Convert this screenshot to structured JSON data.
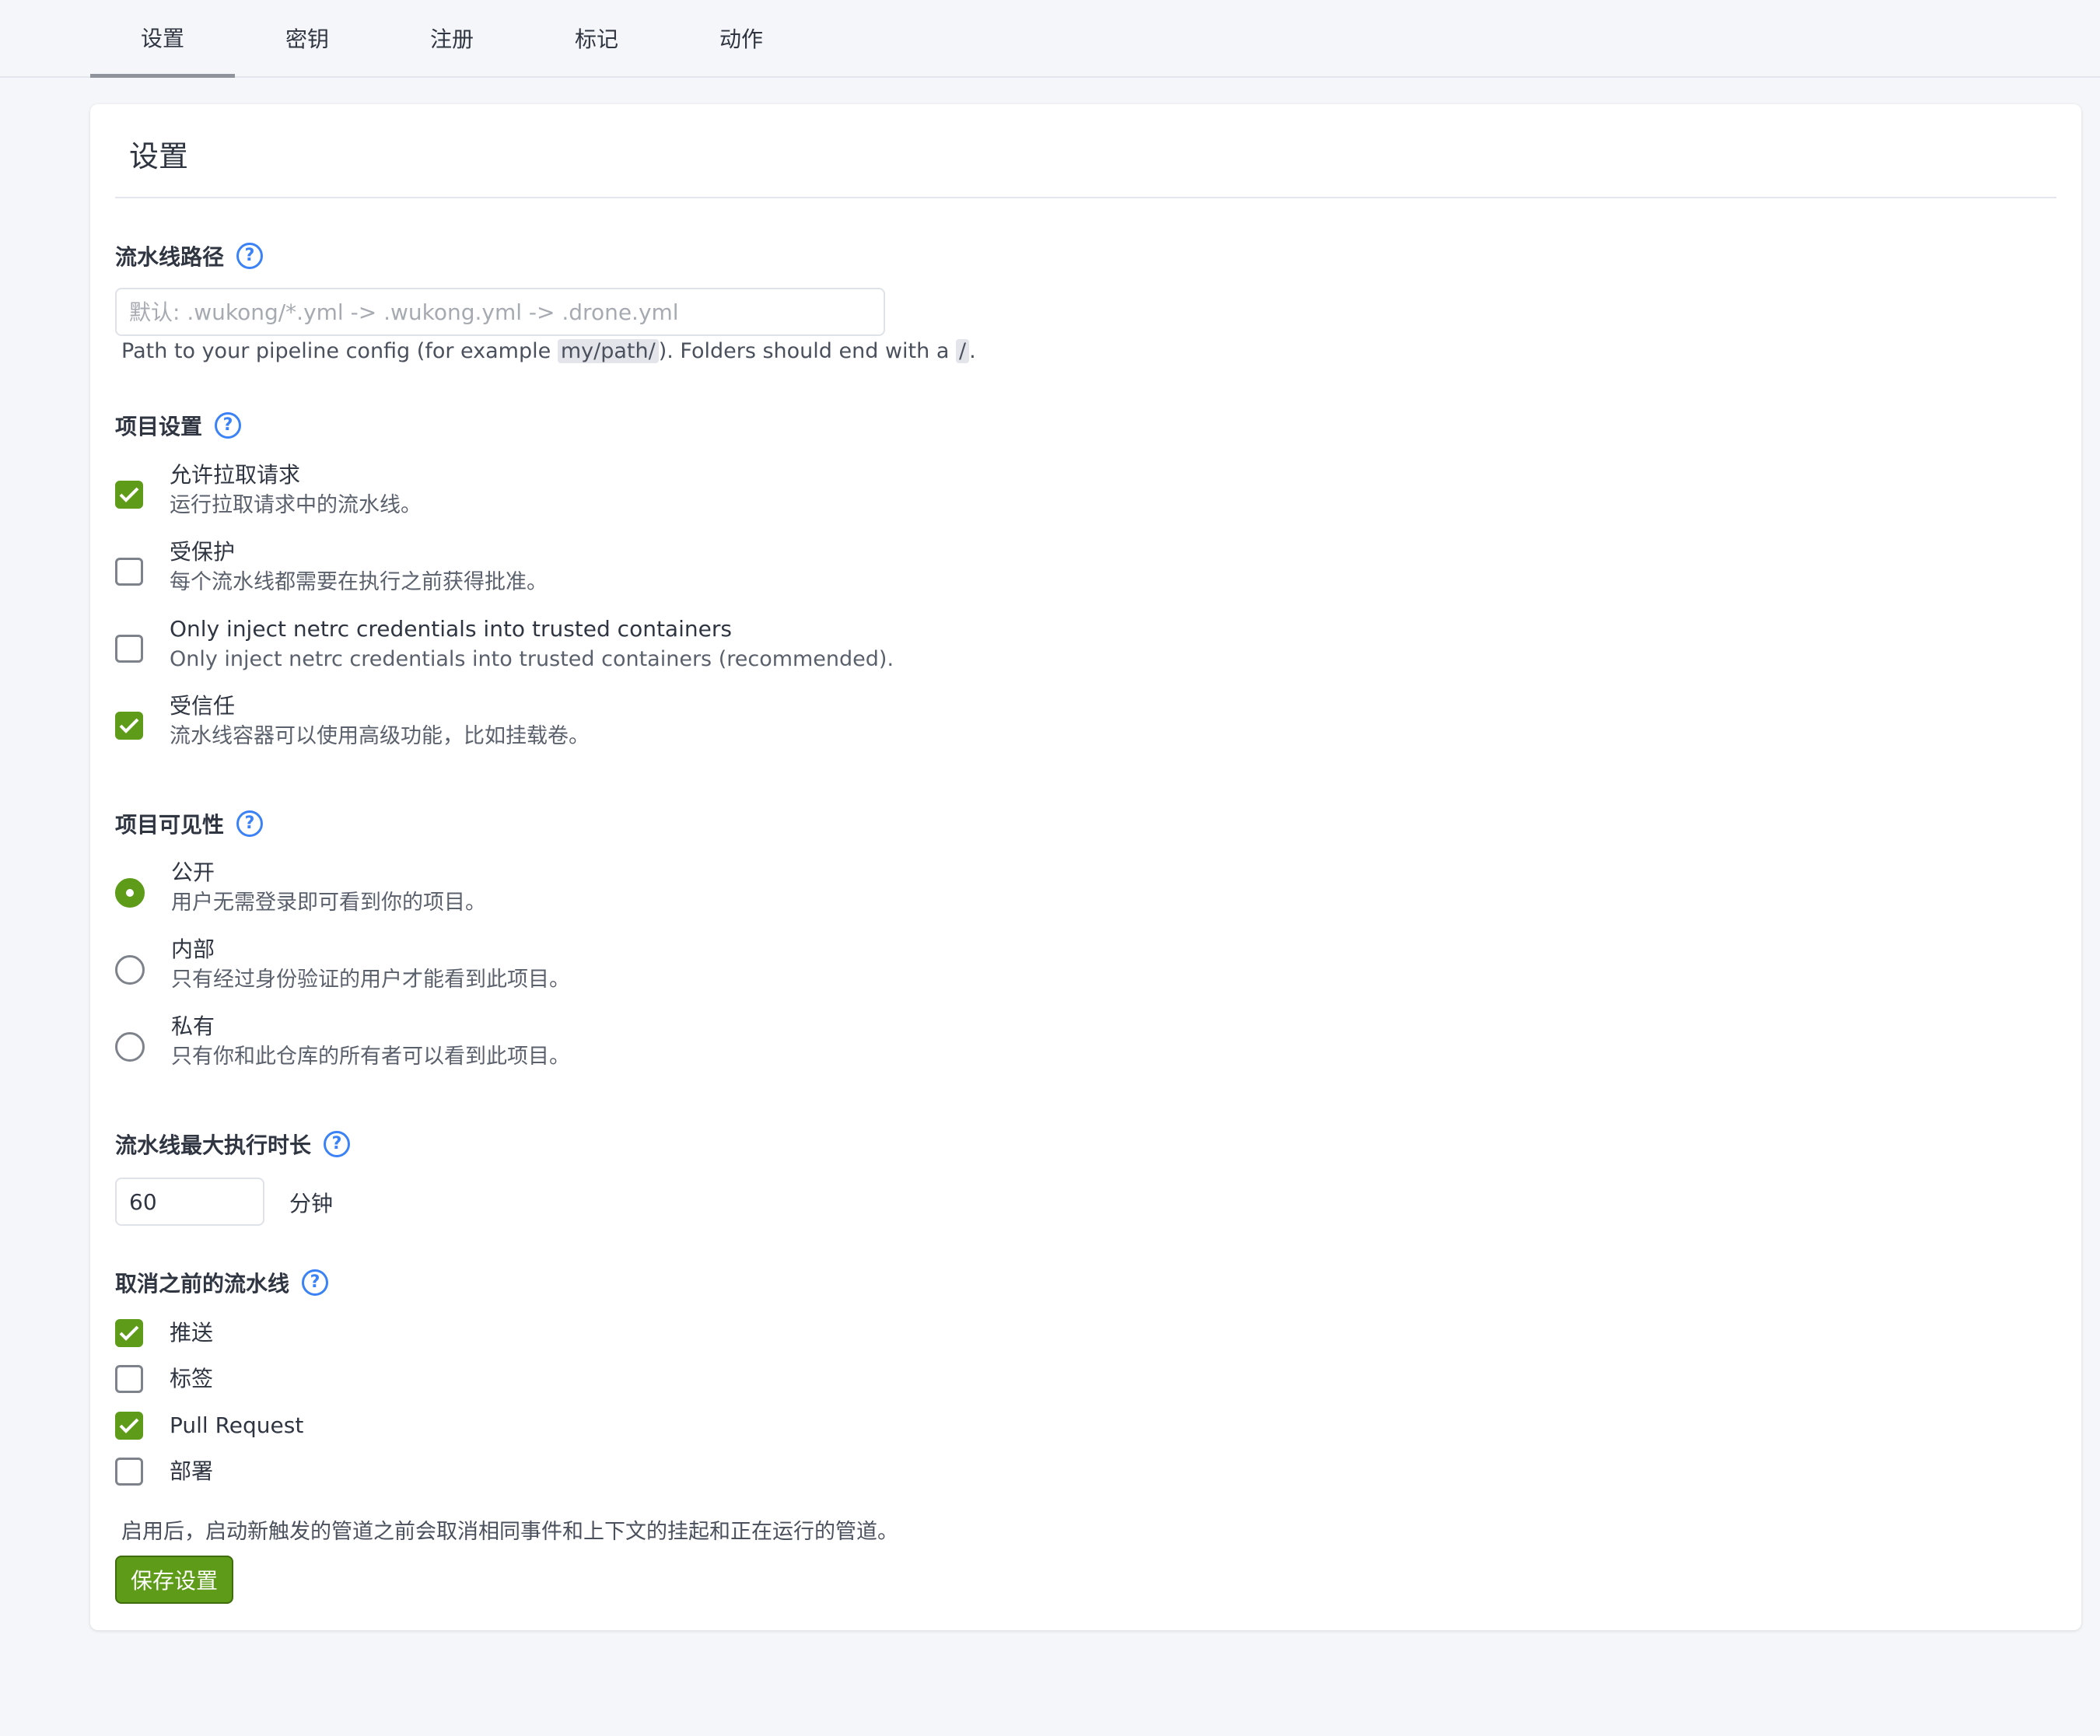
{
  "tabs": [
    "设置",
    "密钥",
    "注册",
    "标记",
    "动作"
  ],
  "active_tab": "设置",
  "card": {
    "title": "设置",
    "pipeline_path": {
      "label": "流水线路径",
      "placeholder": "默认: .wukong/*.yml -> .wukong.yml -> .drone.yml",
      "value": "",
      "hint_before": "Path to your pipeline config (for example ",
      "hint_code1": "my/path/",
      "hint_middle": "). Folders should end with a ",
      "hint_code2": "/",
      "hint_after": "."
    },
    "project_settings": {
      "label": "项目设置",
      "options": [
        {
          "title": "允许拉取请求",
          "desc": "运行拉取请求中的流水线。",
          "checked": true
        },
        {
          "title": "受保护",
          "desc": "每个流水线都需要在执行之前获得批准。",
          "checked": false
        },
        {
          "title": "Only inject netrc credentials into trusted containers",
          "desc": "Only inject netrc credentials into trusted containers (recommended).",
          "checked": false
        },
        {
          "title": "受信任",
          "desc": "流水线容器可以使用高级功能，比如挂载卷。",
          "checked": true
        }
      ]
    },
    "visibility": {
      "label": "项目可见性",
      "options": [
        {
          "title": "公开",
          "desc": "用户无需登录即可看到你的项目。",
          "selected": true
        },
        {
          "title": "内部",
          "desc": "只有经过身份验证的用户才能看到此项目。",
          "selected": false
        },
        {
          "title": "私有",
          "desc": "只有你和此仓库的所有者可以看到此项目。",
          "selected": false
        }
      ]
    },
    "timeout": {
      "label": "流水线最大执行时长",
      "value": "60",
      "unit": "分钟"
    },
    "cancel_previous": {
      "label": "取消之前的流水线",
      "options": [
        {
          "title": "推送",
          "checked": true
        },
        {
          "title": "标签",
          "checked": false
        },
        {
          "title": "Pull Request",
          "checked": true
        },
        {
          "title": "部署",
          "checked": false
        }
      ],
      "hint": "启用后，启动新触发的管道之前会取消相同事件和上下文的挂起和正在运行的管道。"
    },
    "save_label": "保存设置"
  },
  "colors": {
    "accent": "#5d9b18",
    "help": "#3b82f6",
    "background": "#f5f6f9"
  },
  "icons": {
    "help": "question-circle-icon",
    "check": "checkmark-icon"
  }
}
